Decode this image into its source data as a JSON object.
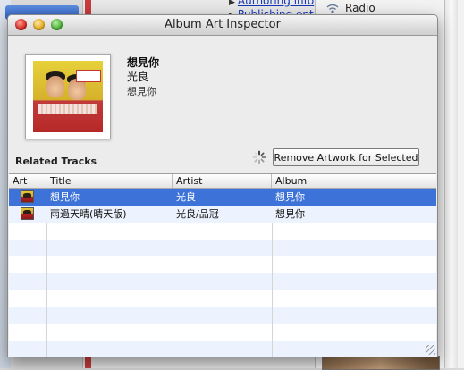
{
  "background": {
    "links": [
      "Authoring info",
      "Publishing opt"
    ],
    "radio_label": "Radio"
  },
  "window": {
    "title": "Album Art Inspector"
  },
  "selection": {
    "title": "想見你",
    "artist": "光良",
    "album": "想見你"
  },
  "related_tracks": {
    "label": "Related Tracks",
    "remove_button": "Remove Artwork for Selected"
  },
  "table": {
    "columns": [
      "Art",
      "Title",
      "Artist",
      "Album"
    ],
    "rows": [
      {
        "title": "想見你",
        "artist": "光良",
        "album": "想見你",
        "selected": true
      },
      {
        "title": "雨過天晴(晴天版)",
        "artist": "光良/品冠",
        "album": "想見你",
        "selected": false
      }
    ]
  },
  "colors": {
    "selection": "#3d73d8",
    "row_alt": "#edf3fe"
  },
  "icons": {
    "close": "close-icon",
    "minimize": "minimize-icon",
    "zoom": "zoom-icon",
    "spinner": "spinner-icon",
    "radio": "radio-icon"
  }
}
